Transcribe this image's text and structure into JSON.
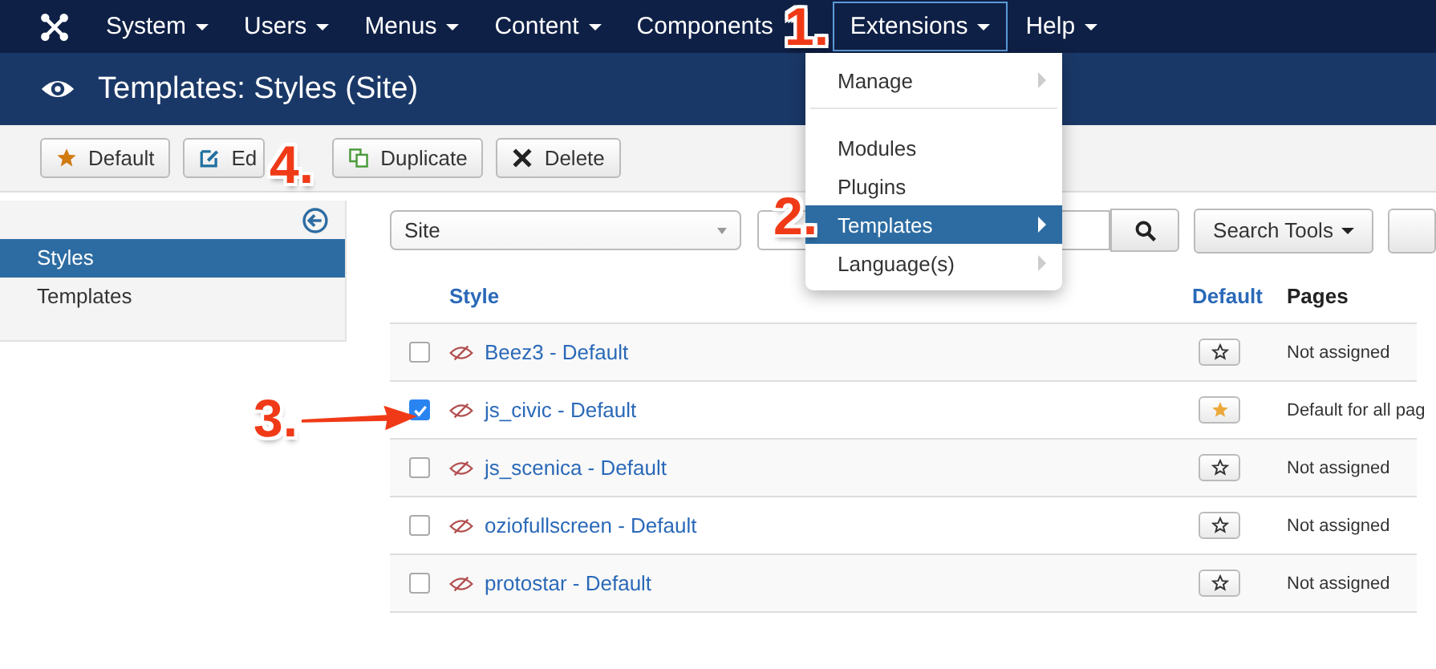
{
  "navbar": {
    "items": [
      {
        "label": "System",
        "caret": true,
        "selected": false
      },
      {
        "label": "Users",
        "caret": true,
        "selected": false
      },
      {
        "label": "Menus",
        "caret": true,
        "selected": false
      },
      {
        "label": "Content",
        "caret": true,
        "selected": false
      },
      {
        "label": "Components",
        "caret": false,
        "selected": false
      },
      {
        "label": "Extensions",
        "caret": true,
        "selected": true
      },
      {
        "label": "Help",
        "caret": true,
        "selected": false
      }
    ]
  },
  "header": {
    "title": "Templates: Styles (Site)"
  },
  "toolbar": {
    "buttons": [
      {
        "label": "Default",
        "kind": "star"
      },
      {
        "label": "Ed",
        "kind": "edit"
      },
      {
        "label": "Duplicate",
        "kind": "duplicate"
      },
      {
        "label": "Delete",
        "kind": "delete"
      }
    ]
  },
  "sidebar": {
    "items": [
      {
        "label": "Styles",
        "selected": true
      },
      {
        "label": "Templates",
        "selected": false
      }
    ]
  },
  "filters": {
    "client_select": {
      "value": "Site"
    },
    "search_tools": "Search Tools"
  },
  "table": {
    "columns": [
      "Style",
      "Default",
      "Pages"
    ],
    "rows": [
      {
        "name": "Beez3 - Default",
        "checked": false,
        "is_default": false,
        "pages": "Not assigned"
      },
      {
        "name": "js_civic - Default",
        "checked": true,
        "is_default": true,
        "pages": "Default for all pag"
      },
      {
        "name": "js_scenica - Default",
        "checked": false,
        "is_default": false,
        "pages": "Not assigned"
      },
      {
        "name": "oziofullscreen - Default",
        "checked": false,
        "is_default": false,
        "pages": "Not assigned"
      },
      {
        "name": "protostar - Default",
        "checked": false,
        "is_default": false,
        "pages": "Not assigned"
      }
    ]
  },
  "menu": {
    "items": [
      {
        "kind": "item",
        "label": "Manage",
        "submenu": true,
        "selected": false
      },
      {
        "kind": "divider"
      },
      {
        "kind": "item",
        "label": "Modules",
        "submenu": false,
        "selected": false
      },
      {
        "kind": "item",
        "label": "Plugins",
        "submenu": false,
        "selected": false
      },
      {
        "kind": "item",
        "label": "Templates",
        "submenu": true,
        "selected": true
      },
      {
        "kind": "item",
        "label": "Language(s)",
        "submenu": true,
        "selected": false
      }
    ]
  },
  "annotations": [
    {
      "label": "1.",
      "kind": "number"
    },
    {
      "label": "2.",
      "kind": "number"
    },
    {
      "label": "3.",
      "kind": "number_arrow"
    },
    {
      "label": "4.",
      "kind": "number"
    }
  ]
}
